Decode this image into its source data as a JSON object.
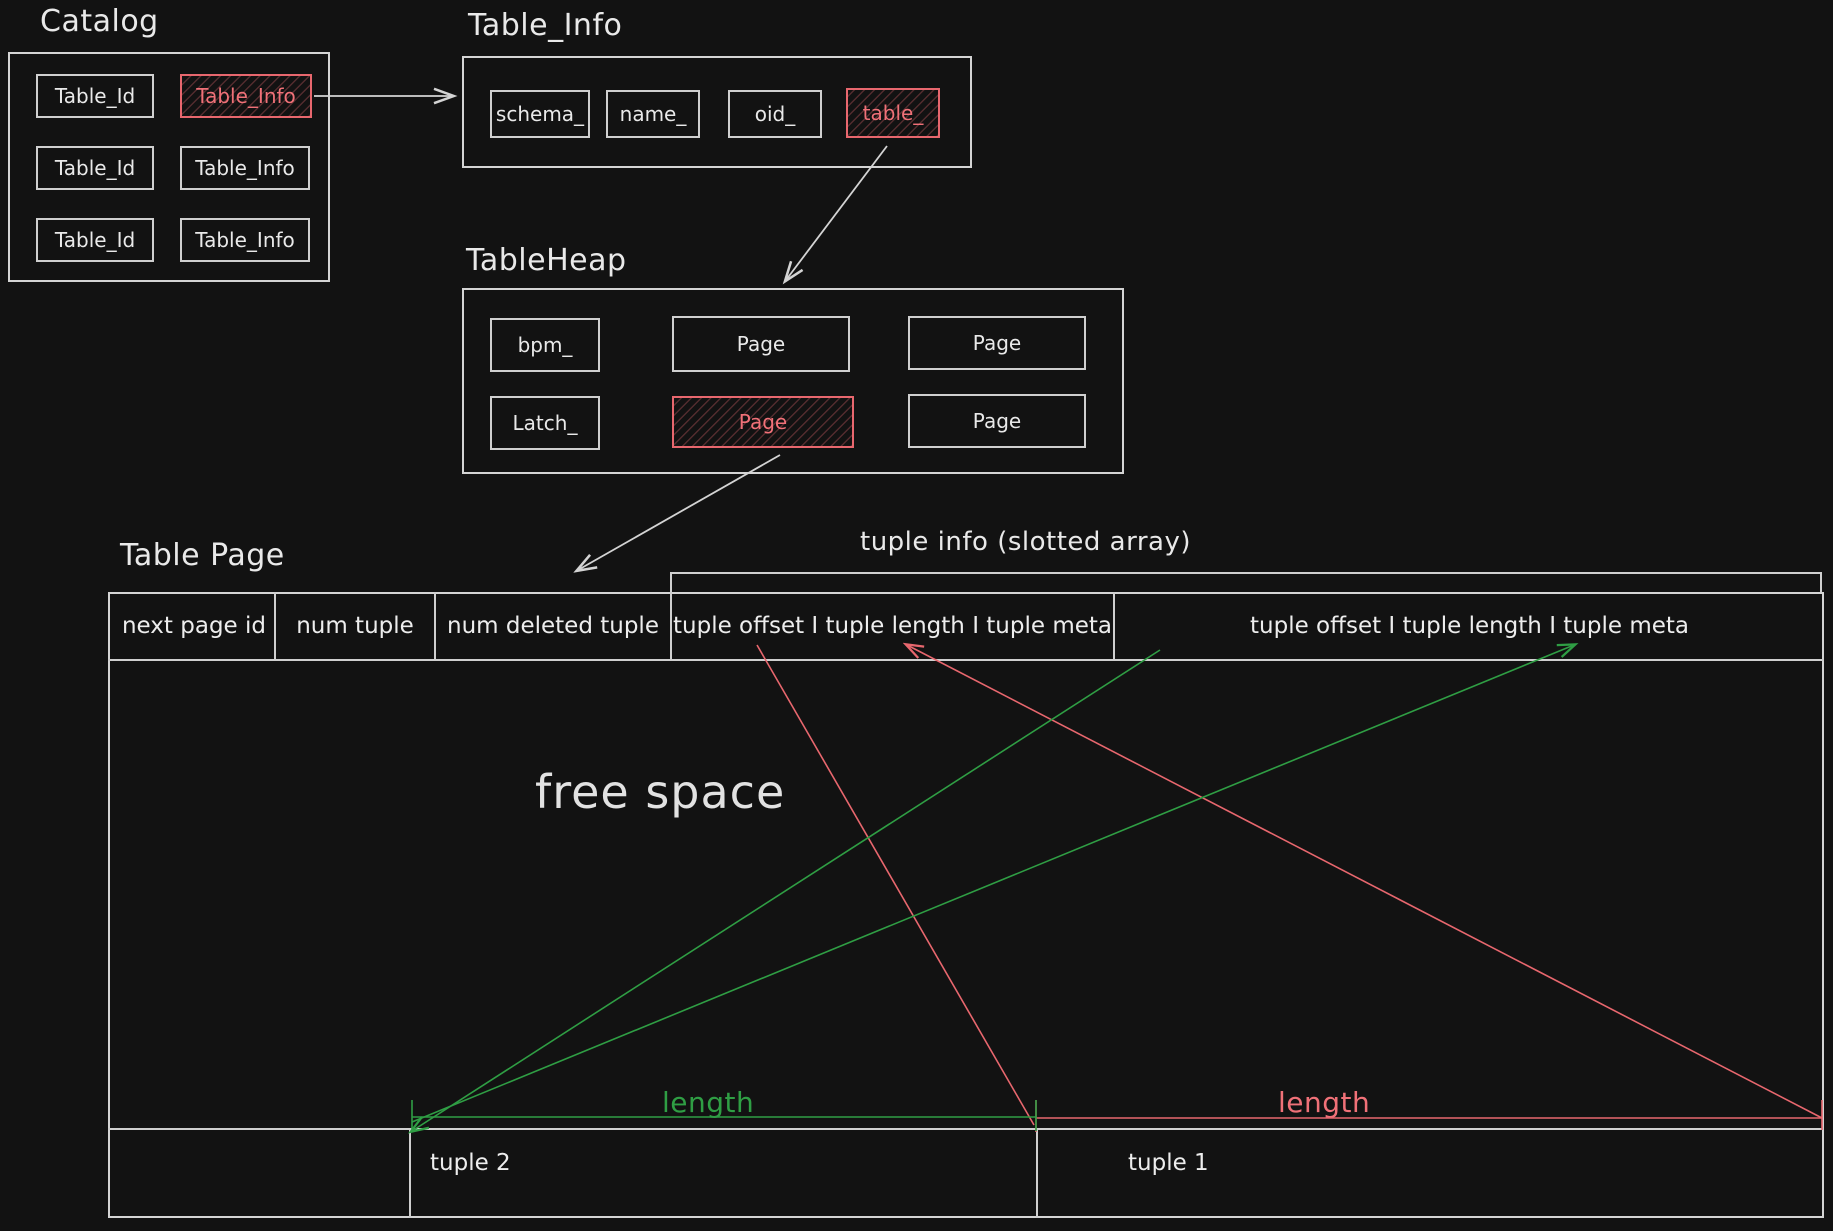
{
  "diagram": {
    "title": "Table Page / Catalog storage layout",
    "background_color": "#121212",
    "stroke_color": "#cfcfcf",
    "highlight_color": "#e8676e",
    "green_color": "#2f9e44",
    "red_color": "#f07178"
  },
  "catalog": {
    "heading": "Catalog",
    "rows": [
      {
        "id_label": "Table_Id",
        "info_label": "Table_Info",
        "info_highlighted": true
      },
      {
        "id_label": "Table_Id",
        "info_label": "Table_Info",
        "info_highlighted": false
      },
      {
        "id_label": "Table_Id",
        "info_label": "Table_Info",
        "info_highlighted": false
      }
    ]
  },
  "table_info": {
    "heading": "Table_Info",
    "fields": [
      {
        "label": "schema_",
        "highlighted": false
      },
      {
        "label": "name_",
        "highlighted": false
      },
      {
        "label": "oid_",
        "highlighted": false
      },
      {
        "label": "table_",
        "highlighted": true
      }
    ]
  },
  "table_heap": {
    "heading": "TableHeap",
    "row1": [
      {
        "label": "bpm_",
        "highlighted": false
      },
      {
        "label": "Page",
        "highlighted": false
      },
      {
        "label": "Page",
        "highlighted": false
      }
    ],
    "row2": [
      {
        "label": "Latch_",
        "highlighted": false
      },
      {
        "label": "Page",
        "highlighted": true
      },
      {
        "label": "Page",
        "highlighted": false
      }
    ]
  },
  "table_page": {
    "heading": "Table Page",
    "tuple_info_caption": "tuple info (slotted array)",
    "header_cells": [
      "next page id",
      "num tuple",
      "num deleted tuple",
      "tuple offset I tuple length I tuple meta",
      "tuple offset I tuple length I tuple meta"
    ],
    "free_space_label": "free space",
    "measure_green_label": "length",
    "measure_red_label": "length",
    "tuples": [
      {
        "label": "tuple 2"
      },
      {
        "label": "tuple 1"
      }
    ]
  }
}
